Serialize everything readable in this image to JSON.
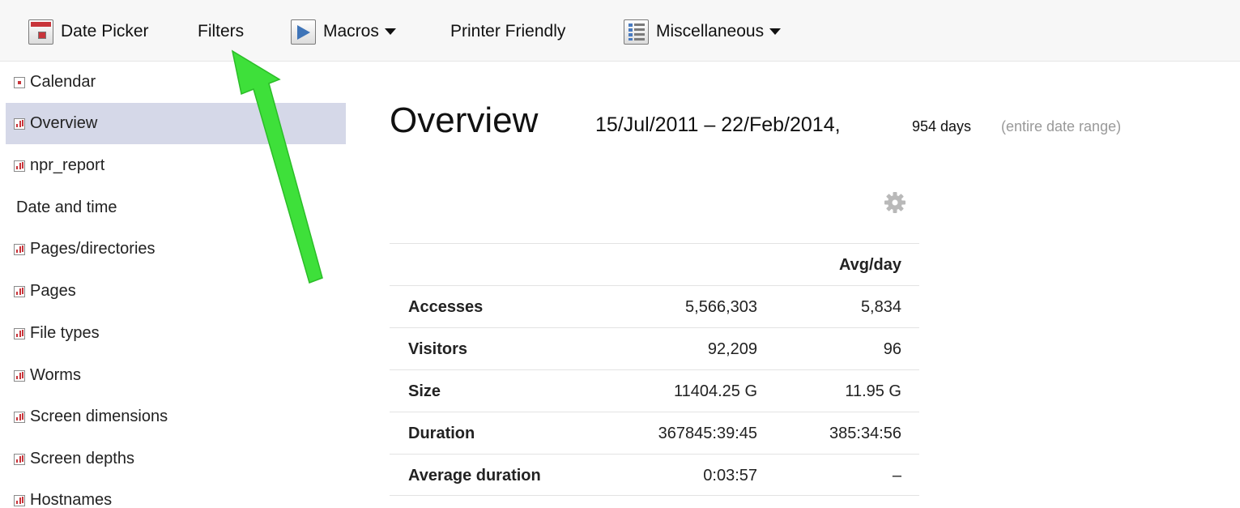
{
  "toolbar": {
    "date_picker": "Date Picker",
    "filters": "Filters",
    "macros": "Macros",
    "printer_friendly": "Printer Friendly",
    "miscellaneous": "Miscellaneous"
  },
  "sidebar": {
    "items": [
      {
        "label": "Calendar"
      },
      {
        "label": "Overview"
      },
      {
        "label": "npr_report"
      },
      {
        "label": "Date and time"
      },
      {
        "label": "Pages/directories"
      },
      {
        "label": "Pages"
      },
      {
        "label": "File types"
      },
      {
        "label": "Worms"
      },
      {
        "label": "Screen dimensions"
      },
      {
        "label": "Screen depths"
      },
      {
        "label": "Hostnames"
      }
    ],
    "selected": "Overview"
  },
  "main": {
    "title": "Overview",
    "date_range": "15/Jul/2011 – 22/Feb/2014,",
    "days": "954 days",
    "range_note": "(entire date range)"
  },
  "stats": {
    "header_avg": "Avg/day",
    "rows": [
      {
        "label": "Accesses",
        "total": "5,566,303",
        "avg": "5,834"
      },
      {
        "label": "Visitors",
        "total": "92,209",
        "avg": "96"
      },
      {
        "label": "Size",
        "total": "11404.25 G",
        "avg": "11.95 G"
      },
      {
        "label": "Duration",
        "total": "367845:39:45",
        "avg": "385:34:56"
      },
      {
        "label": "Average duration",
        "total": "0:03:57",
        "avg": "–"
      }
    ]
  },
  "colors": {
    "accent_arrow": "#3ee03a",
    "selected_row": "#d5d8e8",
    "toolbar_bg": "#f7f7f7"
  },
  "icons": {
    "date_picker": "calendar-icon",
    "macros": "play-icon",
    "miscellaneous": "list-icon",
    "settings": "gear-icon",
    "report": "bar-chart-icon"
  }
}
